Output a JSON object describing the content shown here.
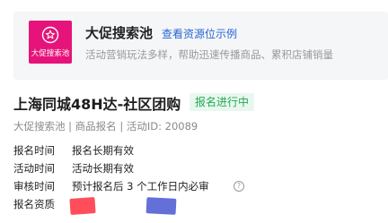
{
  "banner": {
    "logo_caption": "大促搜索池",
    "title": "大促搜索池",
    "link": "查看资源位示例",
    "description": "活动营销玩法多样，帮助迅速传播商品、累积店铺销量"
  },
  "activity": {
    "title": "上海同城48H达-社区团购",
    "status": "报名进行中",
    "meta": "大促搜索池 | 商品报名 | 活动ID: 20089"
  },
  "details": [
    {
      "label": "报名时间",
      "value": "报名长期有效"
    },
    {
      "label": "活动时间",
      "value": "活动长期有效"
    },
    {
      "label": "审核时间",
      "value": "预计报名后 3 个工作日内必审"
    },
    {
      "label": "报名资质",
      "value": ""
    }
  ],
  "colors": {
    "brand_pink": "#e6147a",
    "link_blue": "#2766d6",
    "status_green": "#23a857",
    "redact_red": "#ff4d5b",
    "redact_blue": "#6470d8"
  },
  "icons": {
    "logo": "shop-star-icon",
    "help": "question-circle-icon"
  }
}
